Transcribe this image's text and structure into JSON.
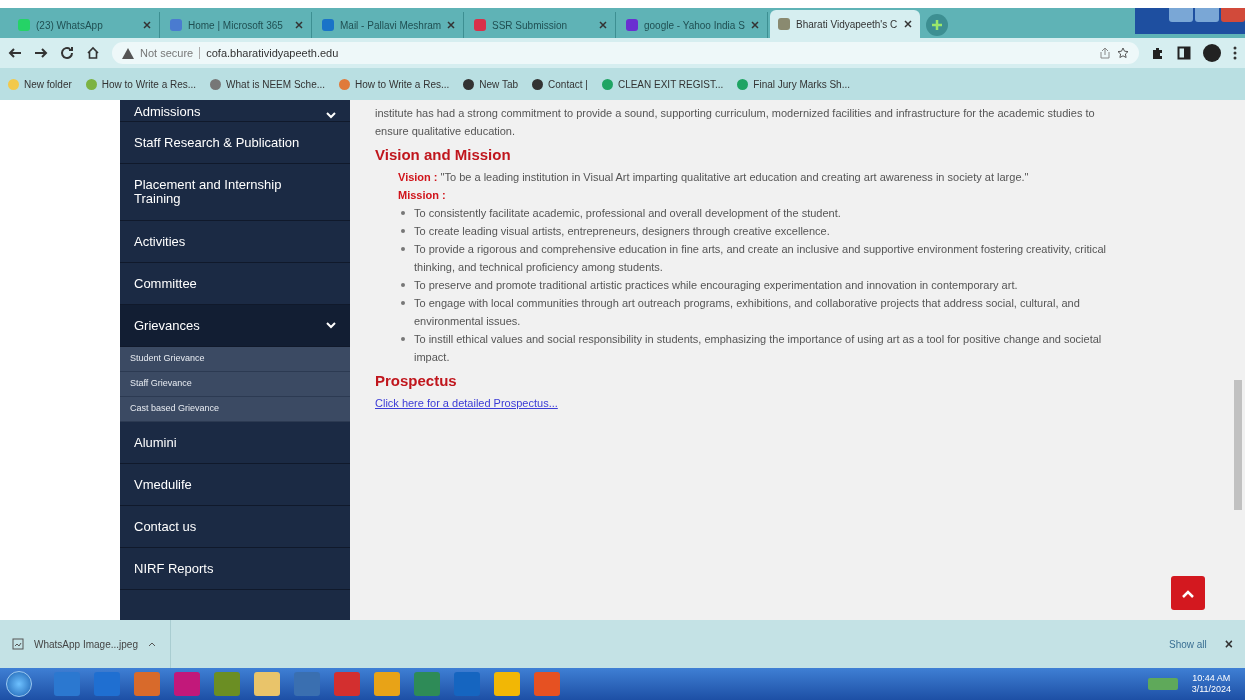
{
  "browser": {
    "tabs": [
      {
        "title": "(23) WhatsApp",
        "selected": false,
        "color": "#25d366"
      },
      {
        "title": "Home | Microsoft 365",
        "selected": false,
        "color": "#4a7bd0"
      },
      {
        "title": "Mail - Pallavi Meshram",
        "selected": false,
        "color": "#1a73c8"
      },
      {
        "title": "SSR Submission",
        "selected": false,
        "color": "#d9304a"
      },
      {
        "title": "google - Yahoo India S",
        "selected": false,
        "color": "#6a2fd1"
      },
      {
        "title": "Bharati Vidyapeeth's C",
        "selected": true,
        "color": "#8a8a70"
      }
    ],
    "address": {
      "security": "Not secure",
      "url": "cofa.bharatividyapeeth.edu"
    },
    "bookmarks": [
      {
        "label": "New folder",
        "color": "#f2c94c"
      },
      {
        "label": "How to Write a Res...",
        "color": "#7cb342"
      },
      {
        "label": "What is NEEM Sche...",
        "color": "#777777"
      },
      {
        "label": "How to Write a Res...",
        "color": "#e07a3a"
      },
      {
        "label": "New Tab",
        "color": "#333333"
      },
      {
        "label": "Contact |",
        "color": "#333333"
      },
      {
        "label": "CLEAN EXIT REGIST...",
        "color": "#1fa463"
      },
      {
        "label": "Final Jury Marks Sh...",
        "color": "#1fa463"
      }
    ]
  },
  "sidebar": {
    "items": [
      {
        "kind": "main",
        "label": "Admissions",
        "expandable": true,
        "expanded": false
      },
      {
        "kind": "main",
        "label": "Staff Research & Publication",
        "expandable": false,
        "expanded": false
      },
      {
        "kind": "main",
        "label": "Placement and Internship Training",
        "expandable": false,
        "expanded": false
      },
      {
        "kind": "main",
        "label": "Activities",
        "expandable": false,
        "expanded": false
      },
      {
        "kind": "main",
        "label": "Committee",
        "expandable": false,
        "expanded": false
      },
      {
        "kind": "main",
        "label": "Grievances",
        "expandable": true,
        "expanded": true,
        "children": [
          {
            "kind": "sub",
            "label": "Student Grievance"
          },
          {
            "kind": "sub",
            "label": "Staff Grievance"
          },
          {
            "kind": "sub",
            "label": "Cast based Grievance"
          }
        ]
      },
      {
        "kind": "main",
        "label": "Alumini",
        "expandable": false,
        "expanded": false
      },
      {
        "kind": "main",
        "label": "Vmedulife",
        "expandable": false,
        "expanded": false
      },
      {
        "kind": "main",
        "label": "Contact us",
        "expandable": false,
        "expanded": false
      },
      {
        "kind": "main",
        "label": "NIRF Reports",
        "expandable": false,
        "expanded": false
      }
    ]
  },
  "content": {
    "intro": "institute has had a strong commitment to provide a sound, supporting curriculum, modernized facilities and infrastructure for the academic studies to ensure qualitative education.",
    "vision_heading": "Vision and Mission",
    "vision": {
      "label": "Vision :",
      "text": "\"To be a leading institution in Visual Art imparting qualitative art education and creating art awareness in society at large.\""
    },
    "mission": {
      "label": "Mission :",
      "items": [
        "To consistently facilitate academic, professional and overall development of the student.",
        "To create leading visual artists, entrepreneurs, designers through creative excellence.",
        "To provide a rigorous and comprehensive education in fine arts, and create an inclusive and supportive environment fostering creativity, critical thinking, and technical proficiency among students.",
        "To preserve and promote traditional artistic practices while encouraging experimentation and innovation in contemporary art.",
        "To engage with local communities through art outreach programs, exhibitions, and collaborative projects that address social, cultural, and environmental issues.",
        "To instill ethical values and social responsibility in students, emphasizing the importance of using art as a tool for positive change and societal impact."
      ]
    },
    "prospectus_heading": "Prospectus",
    "prospectus_link": "Click here for a detailed Prospectus..."
  },
  "downloads": {
    "file": "WhatsApp Image...jpeg",
    "show_all": "Show all",
    "close": "×"
  },
  "taskbar": {
    "apps": [
      {
        "color": "#2b78d0"
      },
      {
        "color": "#1f6fd1"
      },
      {
        "color": "#d86a2b"
      },
      {
        "color": "#c2187a"
      },
      {
        "color": "#6b8e23"
      },
      {
        "color": "#e9c46a"
      },
      {
        "color": "#3a6fb0"
      },
      {
        "color": "#d32f2f"
      },
      {
        "color": "#e8a317"
      },
      {
        "color": "#2e8b57"
      },
      {
        "color": "#1565c0"
      },
      {
        "color": "#f2b705"
      },
      {
        "color": "#e65122"
      }
    ],
    "time": "10:44 AM",
    "date": "3/11/2024"
  }
}
